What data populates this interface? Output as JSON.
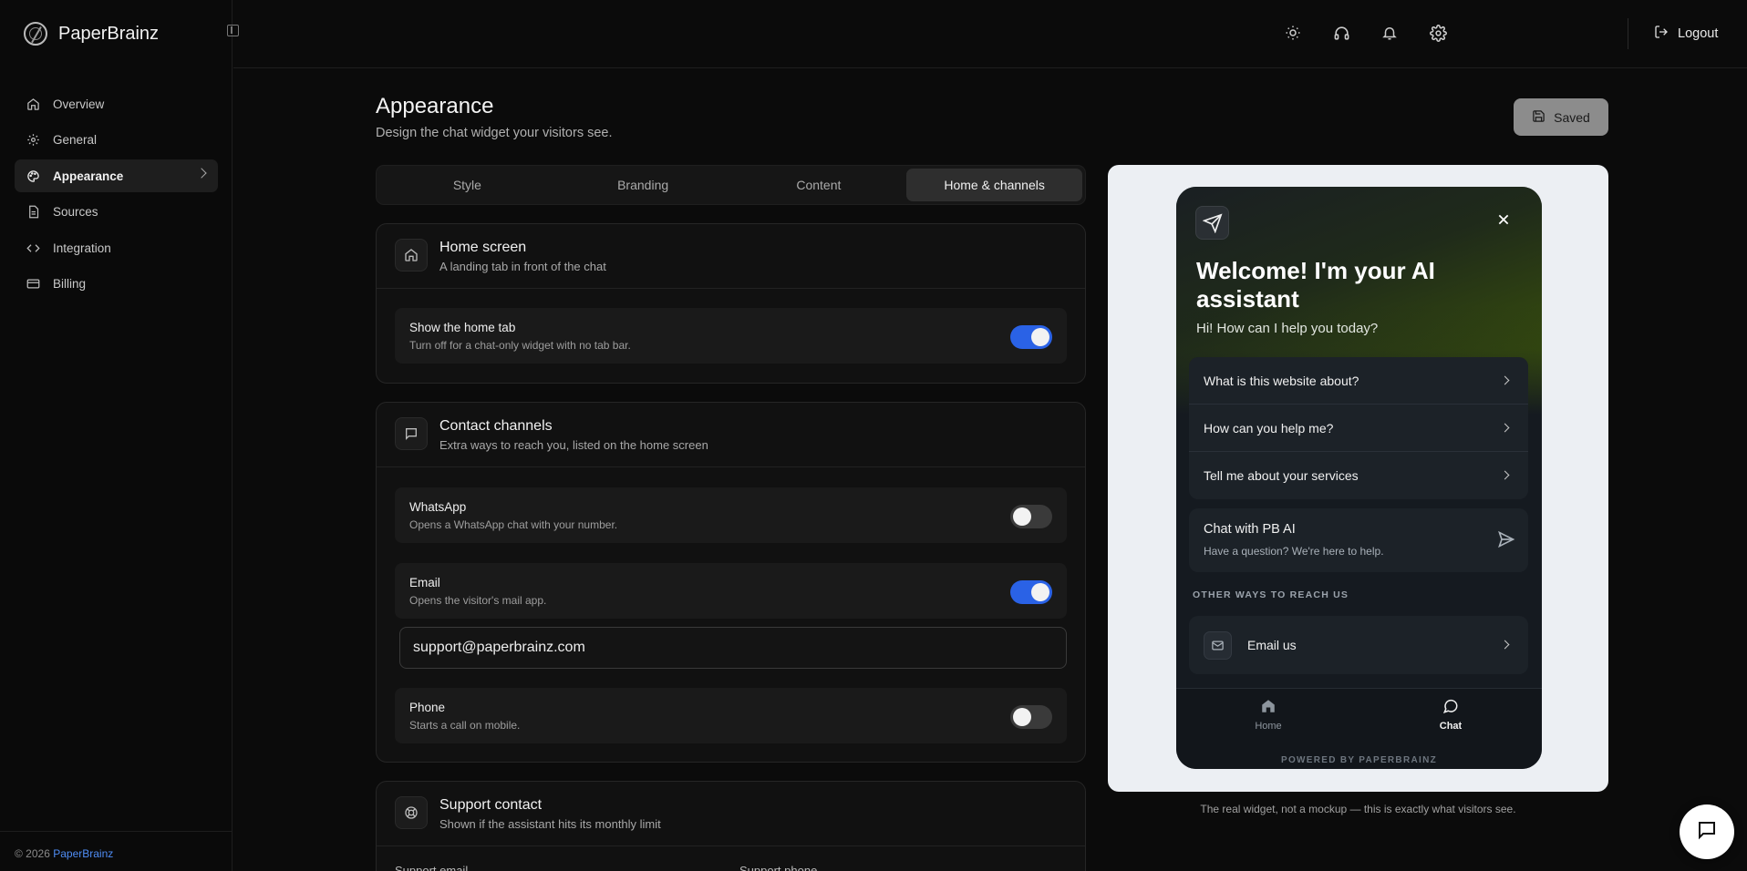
{
  "app": {
    "name": "PaperBrainz"
  },
  "sidebar": {
    "items": [
      {
        "label": "Overview",
        "icon": "home-icon"
      },
      {
        "label": "General",
        "icon": "gear-icon"
      },
      {
        "label": "Appearance",
        "icon": "palette-icon",
        "active": true
      },
      {
        "label": "Sources",
        "icon": "document-icon"
      },
      {
        "label": "Integration",
        "icon": "code-icon"
      },
      {
        "label": "Billing",
        "icon": "card-icon"
      }
    ],
    "footer_text": "© 2026 ",
    "footer_link": "PaperBrainz"
  },
  "topbar": {
    "icons": [
      "sun-icon",
      "headset-icon",
      "bell-icon",
      "gear-icon"
    ],
    "logout_label": "Logout"
  },
  "page": {
    "title": "Appearance",
    "subtitle": "Design the chat widget your visitors see.",
    "saved_label": "Saved"
  },
  "tabs": [
    {
      "label": "Style"
    },
    {
      "label": "Branding"
    },
    {
      "label": "Content"
    },
    {
      "label": "Home & channels",
      "active": true
    }
  ],
  "home_screen": {
    "title": "Home screen",
    "subtitle": "A landing tab in front of the chat",
    "rows": [
      {
        "title": "Show the home tab",
        "subtitle": "Turn off for a chat-only widget with no tab bar.",
        "on": true
      }
    ]
  },
  "contact_channels": {
    "title": "Contact channels",
    "subtitle": "Extra ways to reach you, listed on the home screen",
    "whatsapp": {
      "title": "WhatsApp",
      "subtitle": "Opens a WhatsApp chat with your number.",
      "on": false
    },
    "email": {
      "title": "Email",
      "subtitle": "Opens the visitor's mail app.",
      "on": true,
      "value": "support@paperbrainz.com"
    },
    "phone": {
      "title": "Phone",
      "subtitle": "Starts a call on mobile.",
      "on": false
    }
  },
  "support_contact": {
    "title": "Support contact",
    "subtitle": "Shown if the assistant hits its monthly limit",
    "col1": "Support email",
    "col2": "Support phone"
  },
  "widget": {
    "title": "Welcome! I'm your AI assistant",
    "subtitle": "Hi! How can I help you today?",
    "questions": [
      "What is this website about?",
      "How can you help me?",
      "Tell me about your services"
    ],
    "chat_title": "Chat with PB AI",
    "chat_subtitle": "Have a question? We're here to help.",
    "other_ways": "OTHER WAYS TO REACH US",
    "email_label": "Email us",
    "nav": [
      {
        "label": "Home",
        "icon": "home-filled-icon"
      },
      {
        "label": "Chat",
        "icon": "chat-bubble-icon",
        "active": true
      }
    ],
    "powered": "POWERED BY PAPERBRAINZ"
  },
  "preview_caption": "The real widget, not a mockup — this is exactly what visitors see."
}
